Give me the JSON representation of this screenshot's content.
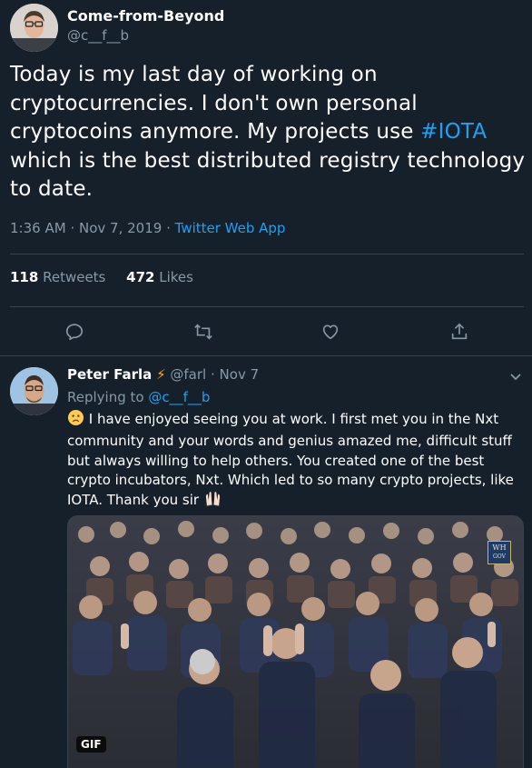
{
  "main_tweet": {
    "author_name": "Come-from-Beyond",
    "author_handle": "@c__f__b",
    "text_before_tag": "Today is my last day of working on cryptocurrencies. I don't own personal cryptocoins anymore. My projects use ",
    "hashtag": "#IOTA",
    "text_after_tag": " which is the best distributed registry technology to date.",
    "time": "1:36 AM",
    "date": "Nov 7, 2019",
    "separator": "·",
    "source": "Twitter Web App",
    "retweets_count": "118",
    "retweets_label": "Retweets",
    "likes_count": "472",
    "likes_label": "Likes"
  },
  "actions": [
    {
      "icon": "reply-icon"
    },
    {
      "icon": "retweet-icon"
    },
    {
      "icon": "like-icon"
    },
    {
      "icon": "share-icon"
    }
  ],
  "reply": {
    "author_name": "Peter Farla",
    "badge_icon": "lightning-icon",
    "badge_glyph": "⚡",
    "author_handle": "@farl",
    "date": "Nov 7",
    "separator": "·",
    "replying_label": "Replying to ",
    "replying_handle": "@c__f__b",
    "text": "I have enjoyed seeing you at work. I first met you in the Nxt community and your words and genius amazed me, difficult stuff but always willing to help others. You created one of the best crypto incubators, Nxt. Which led to so many crypto projects, like IOTA. Thank you sir",
    "gif_label": "GIF",
    "watermark_line1": "WH",
    "watermark_line2": "GOV"
  },
  "colors": {
    "background": "#15202b",
    "accent": "#1da1f2",
    "muted": "#8899a6",
    "divider": "#38444d",
    "badge": "#ffad1f"
  }
}
